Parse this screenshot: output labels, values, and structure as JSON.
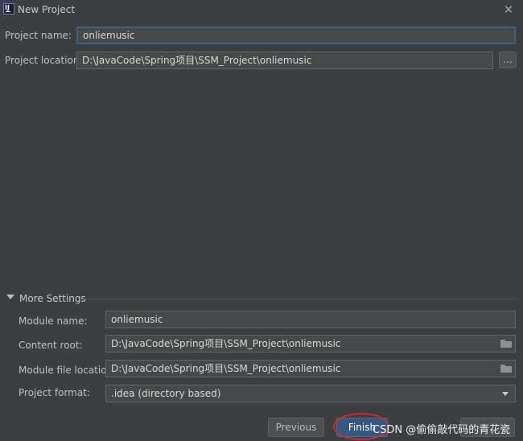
{
  "window": {
    "title": "New Project"
  },
  "project": {
    "name_label": "Project name:",
    "name_value": "onliemusic",
    "location_label": "Project location:",
    "location_value": "D:\\JavaCode\\Spring项目\\SSM_Project\\onliemusic",
    "browse_label": "..."
  },
  "more_settings": {
    "label": "More Settings",
    "module_name_label": "Module name:",
    "module_name_value": "onliemusic",
    "content_root_label": "Content root:",
    "content_root_value": "D:\\JavaCode\\Spring项目\\SSM_Project\\onliemusic",
    "module_file_location_label": "Module file location:",
    "module_file_location_value": "D:\\JavaCode\\Spring项目\\SSM_Project\\onliemusic",
    "project_format_label": "Project format:",
    "project_format_value": ".idea (directory based)"
  },
  "footer": {
    "previous_label": "Previous",
    "finish_label": "Finish"
  },
  "watermark": "CSDN @偷偷敲代码的青花瓷",
  "colors": {
    "background": "#3c3f41",
    "field_bg": "#45494a",
    "focus_border": "#3d6185",
    "primary_button": "#365880",
    "annotation": "#d42a2a"
  },
  "icons": {
    "app": "intellij-idea-icon",
    "close": "close-icon",
    "folder": "folder-icon",
    "toggle": "triangle-down-icon",
    "dropdown": "chevron-down-icon"
  }
}
